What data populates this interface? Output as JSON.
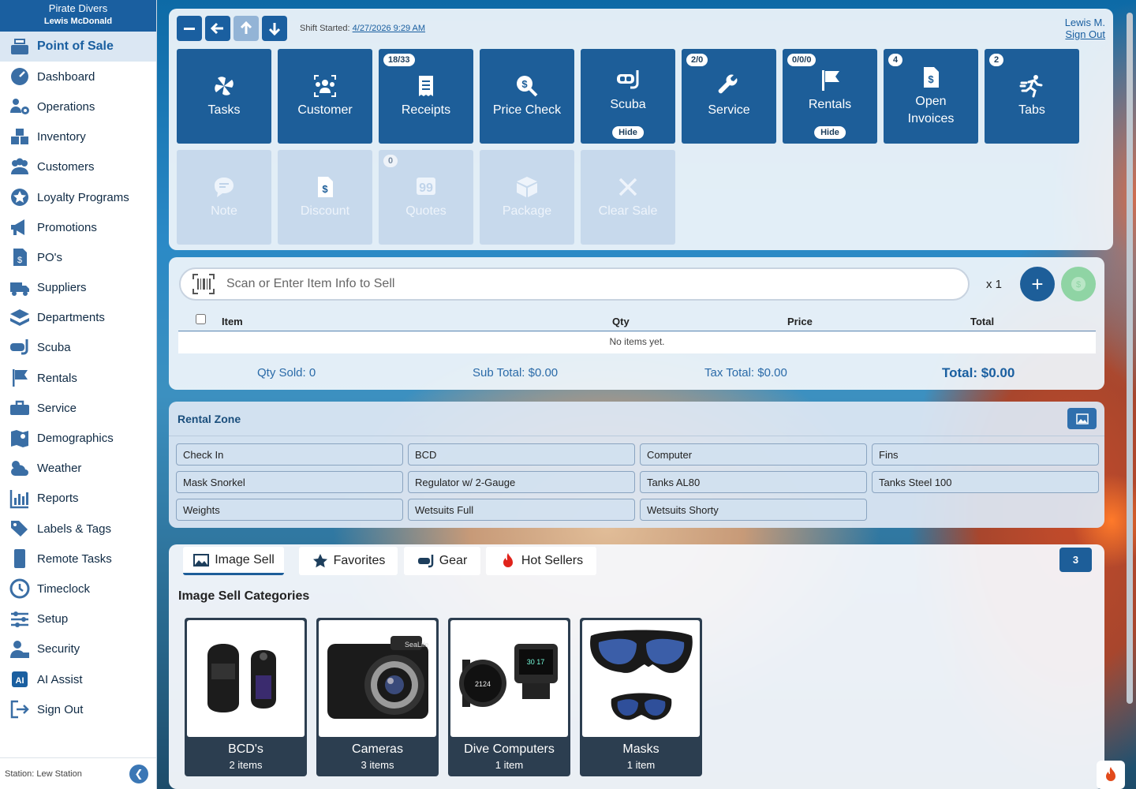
{
  "brand": {
    "company": "Pirate Divers",
    "user": "Lewis McDonald"
  },
  "sidebar": {
    "items": [
      {
        "label": "Point of Sale",
        "icon": "cash-register-icon"
      },
      {
        "label": "Dashboard",
        "icon": "gauge-icon"
      },
      {
        "label": "Operations",
        "icon": "users-gear-icon"
      },
      {
        "label": "Inventory",
        "icon": "boxes-icon"
      },
      {
        "label": "Customers",
        "icon": "people-icon"
      },
      {
        "label": "Loyalty Programs",
        "icon": "star-badge-icon"
      },
      {
        "label": "Promotions",
        "icon": "megaphone-icon"
      },
      {
        "label": "PO's",
        "icon": "invoice-icon"
      },
      {
        "label": "Suppliers",
        "icon": "truck-icon"
      },
      {
        "label": "Departments",
        "icon": "layers-icon"
      },
      {
        "label": "Scuba",
        "icon": "mask-snorkel-icon"
      },
      {
        "label": "Rentals",
        "icon": "flag-icon"
      },
      {
        "label": "Service",
        "icon": "toolbox-icon"
      },
      {
        "label": "Demographics",
        "icon": "map-pin-icon"
      },
      {
        "label": "Weather",
        "icon": "cloud-sun-icon"
      },
      {
        "label": "Reports",
        "icon": "bar-chart-icon"
      },
      {
        "label": "Labels & Tags",
        "icon": "tags-icon"
      },
      {
        "label": "Remote Tasks",
        "icon": "tablet-icon"
      },
      {
        "label": "Timeclock",
        "icon": "clock-icon"
      },
      {
        "label": "Setup",
        "icon": "sliders-icon"
      },
      {
        "label": "Security",
        "icon": "user-lock-icon"
      },
      {
        "label": "AI Assist",
        "icon": "ai-icon"
      },
      {
        "label": "Sign Out",
        "icon": "sign-out-icon"
      }
    ],
    "station": "Station: Lew Station"
  },
  "header": {
    "shift_label": "Shift Started:",
    "shift_value": "4/27/2026 9:29 AM",
    "user_short": "Lewis M.",
    "sign_out": "Sign Out"
  },
  "tiles": [
    {
      "label": "Tasks",
      "icon": "pinwheel-icon",
      "badge": "",
      "hide": ""
    },
    {
      "label": "Customer",
      "icon": "customer-group-icon",
      "badge": "",
      "hide": ""
    },
    {
      "label": "Receipts",
      "icon": "receipt-icon",
      "badge": "18/33",
      "hide": ""
    },
    {
      "label": "Price Check",
      "icon": "price-search-icon",
      "badge": "",
      "hide": ""
    },
    {
      "label": "Scuba",
      "icon": "mask-snorkel-icon",
      "badge": "",
      "hide": "Hide"
    },
    {
      "label": "Service",
      "icon": "wrench-icon",
      "badge": "2/0",
      "hide": ""
    },
    {
      "label": "Rentals",
      "icon": "flag-icon",
      "badge": "0/0/0",
      "hide": "Hide"
    },
    {
      "label": "Open Invoices",
      "icon": "invoice-dollar-icon",
      "badge": "4",
      "hide": ""
    },
    {
      "label": "Tabs",
      "icon": "runner-icon",
      "badge": "2",
      "hide": ""
    }
  ],
  "tiles2": [
    {
      "label": "Note",
      "icon": "comment-icon",
      "badge": ""
    },
    {
      "label": "Discount",
      "icon": "invoice-dollar-icon",
      "badge": ""
    },
    {
      "label": "Quotes",
      "icon": "quote-icon",
      "badge": "0"
    },
    {
      "label": "Package",
      "icon": "box-icon",
      "badge": ""
    },
    {
      "label": "Clear Sale",
      "icon": "x-icon",
      "badge": ""
    }
  ],
  "sale": {
    "placeholder": "Scan or Enter Item Info to Sell",
    "qty": "x 1",
    "columns": [
      "Item",
      "Qty",
      "Price",
      "Total"
    ],
    "empty": "No items yet.",
    "qty_sold": "Qty Sold:  0",
    "sub_total": "Sub Total:  $0.00",
    "tax_total": "Tax Total:  $0.00",
    "total_label": "Total:",
    "total_value": "$0.00"
  },
  "rental": {
    "title": "Rental Zone",
    "buttons": [
      "Check In",
      "BCD",
      "Computer",
      "Fins",
      "Mask Snorkel",
      "Regulator w/ 2-Gauge",
      "Tanks AL80",
      "Tanks Steel 100",
      "Weights",
      "Wetsuits Full",
      "Wetsuits Shorty"
    ]
  },
  "tabs": [
    {
      "label": "Image Sell",
      "icon": "image-icon"
    },
    {
      "label": "Favorites",
      "icon": "star-icon"
    },
    {
      "label": "Gear",
      "icon": "mask-snorkel-icon"
    },
    {
      "label": "Hot Sellers",
      "icon": "fire-icon"
    }
  ],
  "tab_count": "3",
  "categories_title": "Image Sell Categories",
  "categories": [
    {
      "name": "BCD's",
      "count": "2 items"
    },
    {
      "name": "Cameras",
      "count": "3 items"
    },
    {
      "name": "Dive Computers",
      "count": "1 item"
    },
    {
      "name": "Masks",
      "count": "1 item"
    }
  ]
}
